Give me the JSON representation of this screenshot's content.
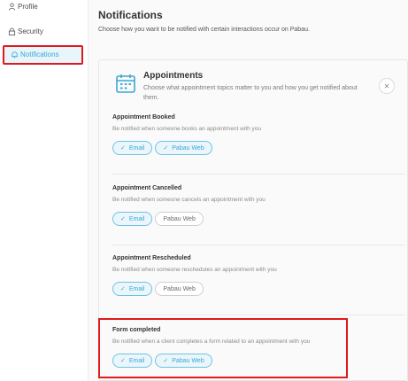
{
  "sidebar": {
    "items": [
      {
        "label": "Profile"
      },
      {
        "label": "Security"
      },
      {
        "label": "Notifications"
      }
    ]
  },
  "main": {
    "title": "Notifications",
    "subtitle": "Choose how you want to be notified with certain interactions occur on Pabau."
  },
  "appointments": {
    "title": "Appointments",
    "description": "Choose what appointment topics matter to you and how you get notified about them.",
    "collapse_icon": "collapse-icon",
    "sections": [
      {
        "title": "Appointment Booked",
        "description": "Be notified when someone books an appointment with you",
        "channels": [
          {
            "label": "Email",
            "enabled": true
          },
          {
            "label": "Pabau Web",
            "enabled": true
          }
        ]
      },
      {
        "title": "Appointment Cancelled",
        "description": "Be notified when someone cancels an appointment with you",
        "channels": [
          {
            "label": "Email",
            "enabled": true
          },
          {
            "label": "Pabau Web",
            "enabled": false
          }
        ]
      },
      {
        "title": "Appointment Rescheduled",
        "description": "Be notified when someone reschedules an appointment with you",
        "channels": [
          {
            "label": "Email",
            "enabled": true
          },
          {
            "label": "Pabau Web",
            "enabled": false
          }
        ]
      },
      {
        "title": "Form completed",
        "description": "Be notified when a client completes a form related to an appointment with you",
        "channels": [
          {
            "label": "Email",
            "enabled": true
          },
          {
            "label": "Pabau Web",
            "enabled": true
          }
        ]
      }
    ]
  },
  "colors": {
    "accent": "#3aa7d4",
    "highlight": "#e0191d"
  }
}
